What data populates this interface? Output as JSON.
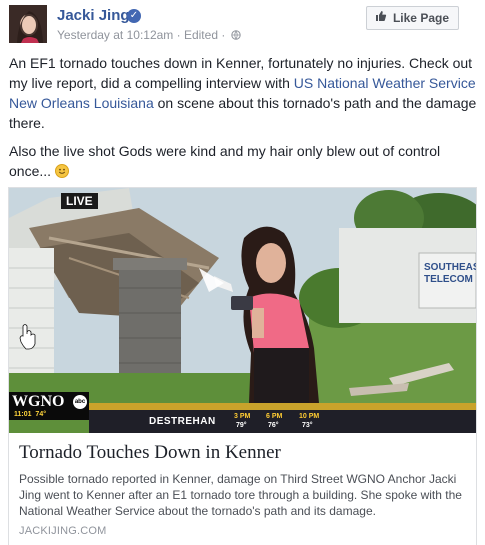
{
  "post": {
    "author_name": "Jacki Jing",
    "meta_text": "Yesterday at 10:12am · Edited ·",
    "like_button_label": "Like Page",
    "paragraph1_plain": "An EF1 tornado touches down in Kenner, fortunately no injuries. Check out my live report, did a compelling interview with ",
    "paragraph1_link": "US National Weather Service New Orleans Louisiana",
    "paragraph1_tail": " on scene about this tornado's path and the damage there.",
    "paragraph2": "Also the live shot Gods were kind and my hair only blew out of control once..."
  },
  "card": {
    "video_overlay": {
      "live_badge": "LIVE",
      "station_logo": "WGNO",
      "network_badge": "abc",
      "station_time": "11:01",
      "station_temp": "74°",
      "ticker_city": "DESTREHAN",
      "forecast": [
        {
          "time": "3 PM",
          "temp": "79°"
        },
        {
          "time": "6 PM",
          "temp": "76°"
        },
        {
          "time": "10 PM",
          "temp": "73°"
        }
      ],
      "store_sign": "SOUTHEAS TELECOM"
    },
    "title": "Tornado Touches Down in Kenner",
    "description": "Possible tornado reported in Kenner, damage on Third Street WGNO Anchor Jacki Jing went to Kenner after an E1 tornado tore through a building. She spoke with the National Weather Service about the tornado's path and its damage.",
    "domain": "JACKIJING.COM"
  },
  "colors": {
    "link": "#365899",
    "verified": "#4267b2",
    "ticker_gold": "#c9a32b"
  },
  "icons": [
    "verified-badge-icon",
    "globe-icon",
    "like-thumb-icon",
    "smile-emoji-icon",
    "cursor-hand-icon"
  ]
}
